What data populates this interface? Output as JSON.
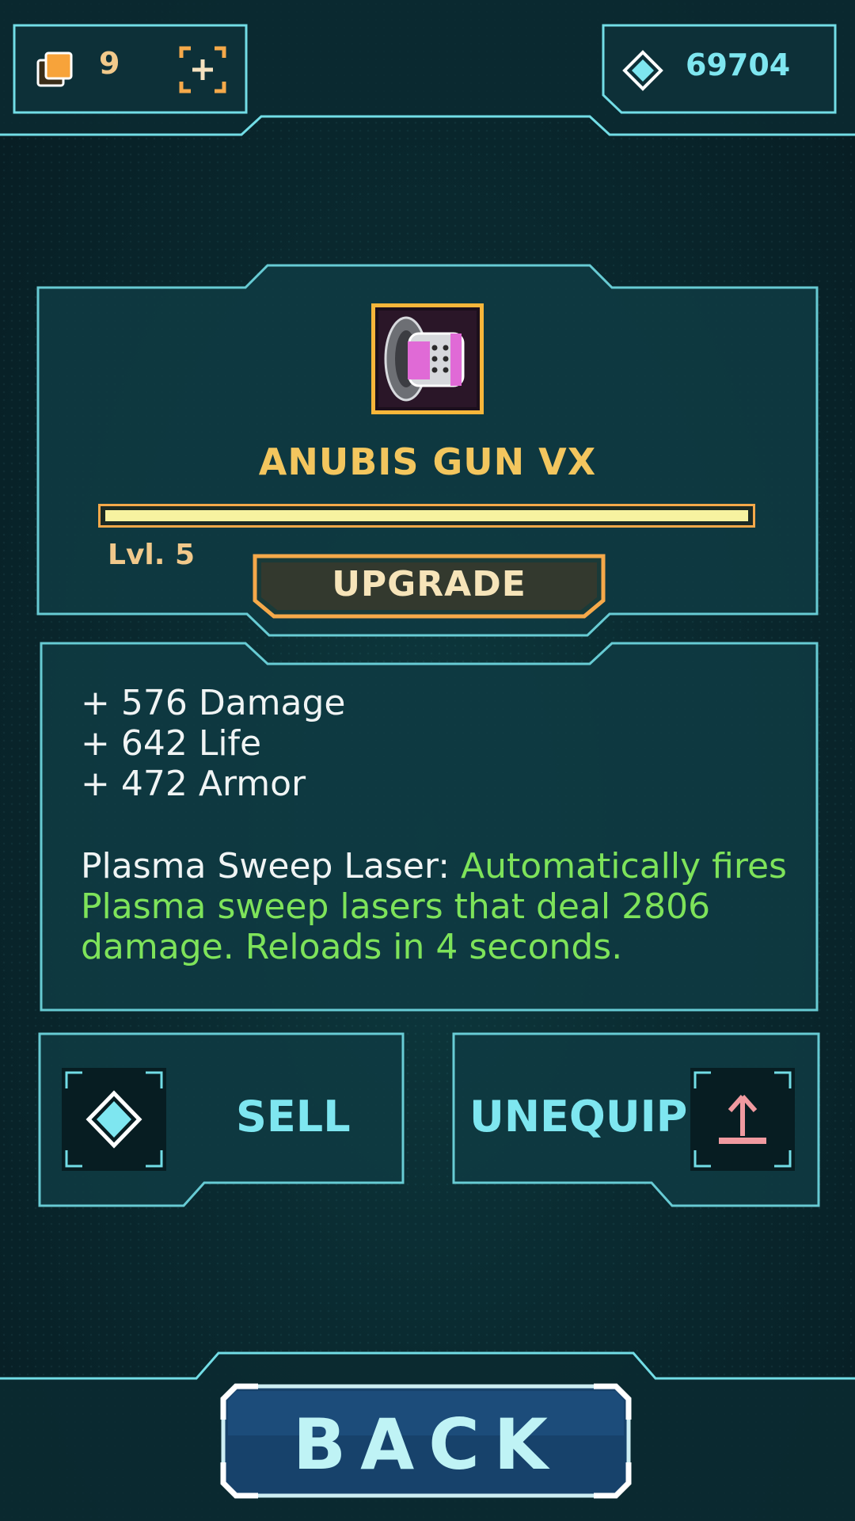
{
  "resources": {
    "cards_count": "9",
    "gems_count": "69704"
  },
  "item": {
    "name": "ANUBIS GUN VX",
    "level_label": "Lvl. 5",
    "level_progress": 1.0,
    "upgrade_label": "UPGRADE"
  },
  "stats": [
    "+ 576 Damage",
    "+ 642 Life",
    "+ 472 Armor"
  ],
  "ability": {
    "name": "Plasma Sweep Laser:",
    "description": "Automatically fires Plasma sweep lasers that deal 2806 damage. Reloads in 4 seconds."
  },
  "actions": {
    "sell_label": "SELL",
    "unequip_label": "UNEQUIP",
    "back_label": "BACK"
  },
  "colors": {
    "accent_cyan": "#7ee6f0",
    "gold": "#f3c65e",
    "orange_frame": "#f5a94a",
    "ability_green": "#7ee35a",
    "unequip_arrow": "#f09aa0"
  },
  "icons": [
    "cards-icon",
    "add-frame-icon",
    "gem-icon",
    "weapon-icon",
    "sell-gem-icon",
    "unequip-arrow-icon"
  ]
}
